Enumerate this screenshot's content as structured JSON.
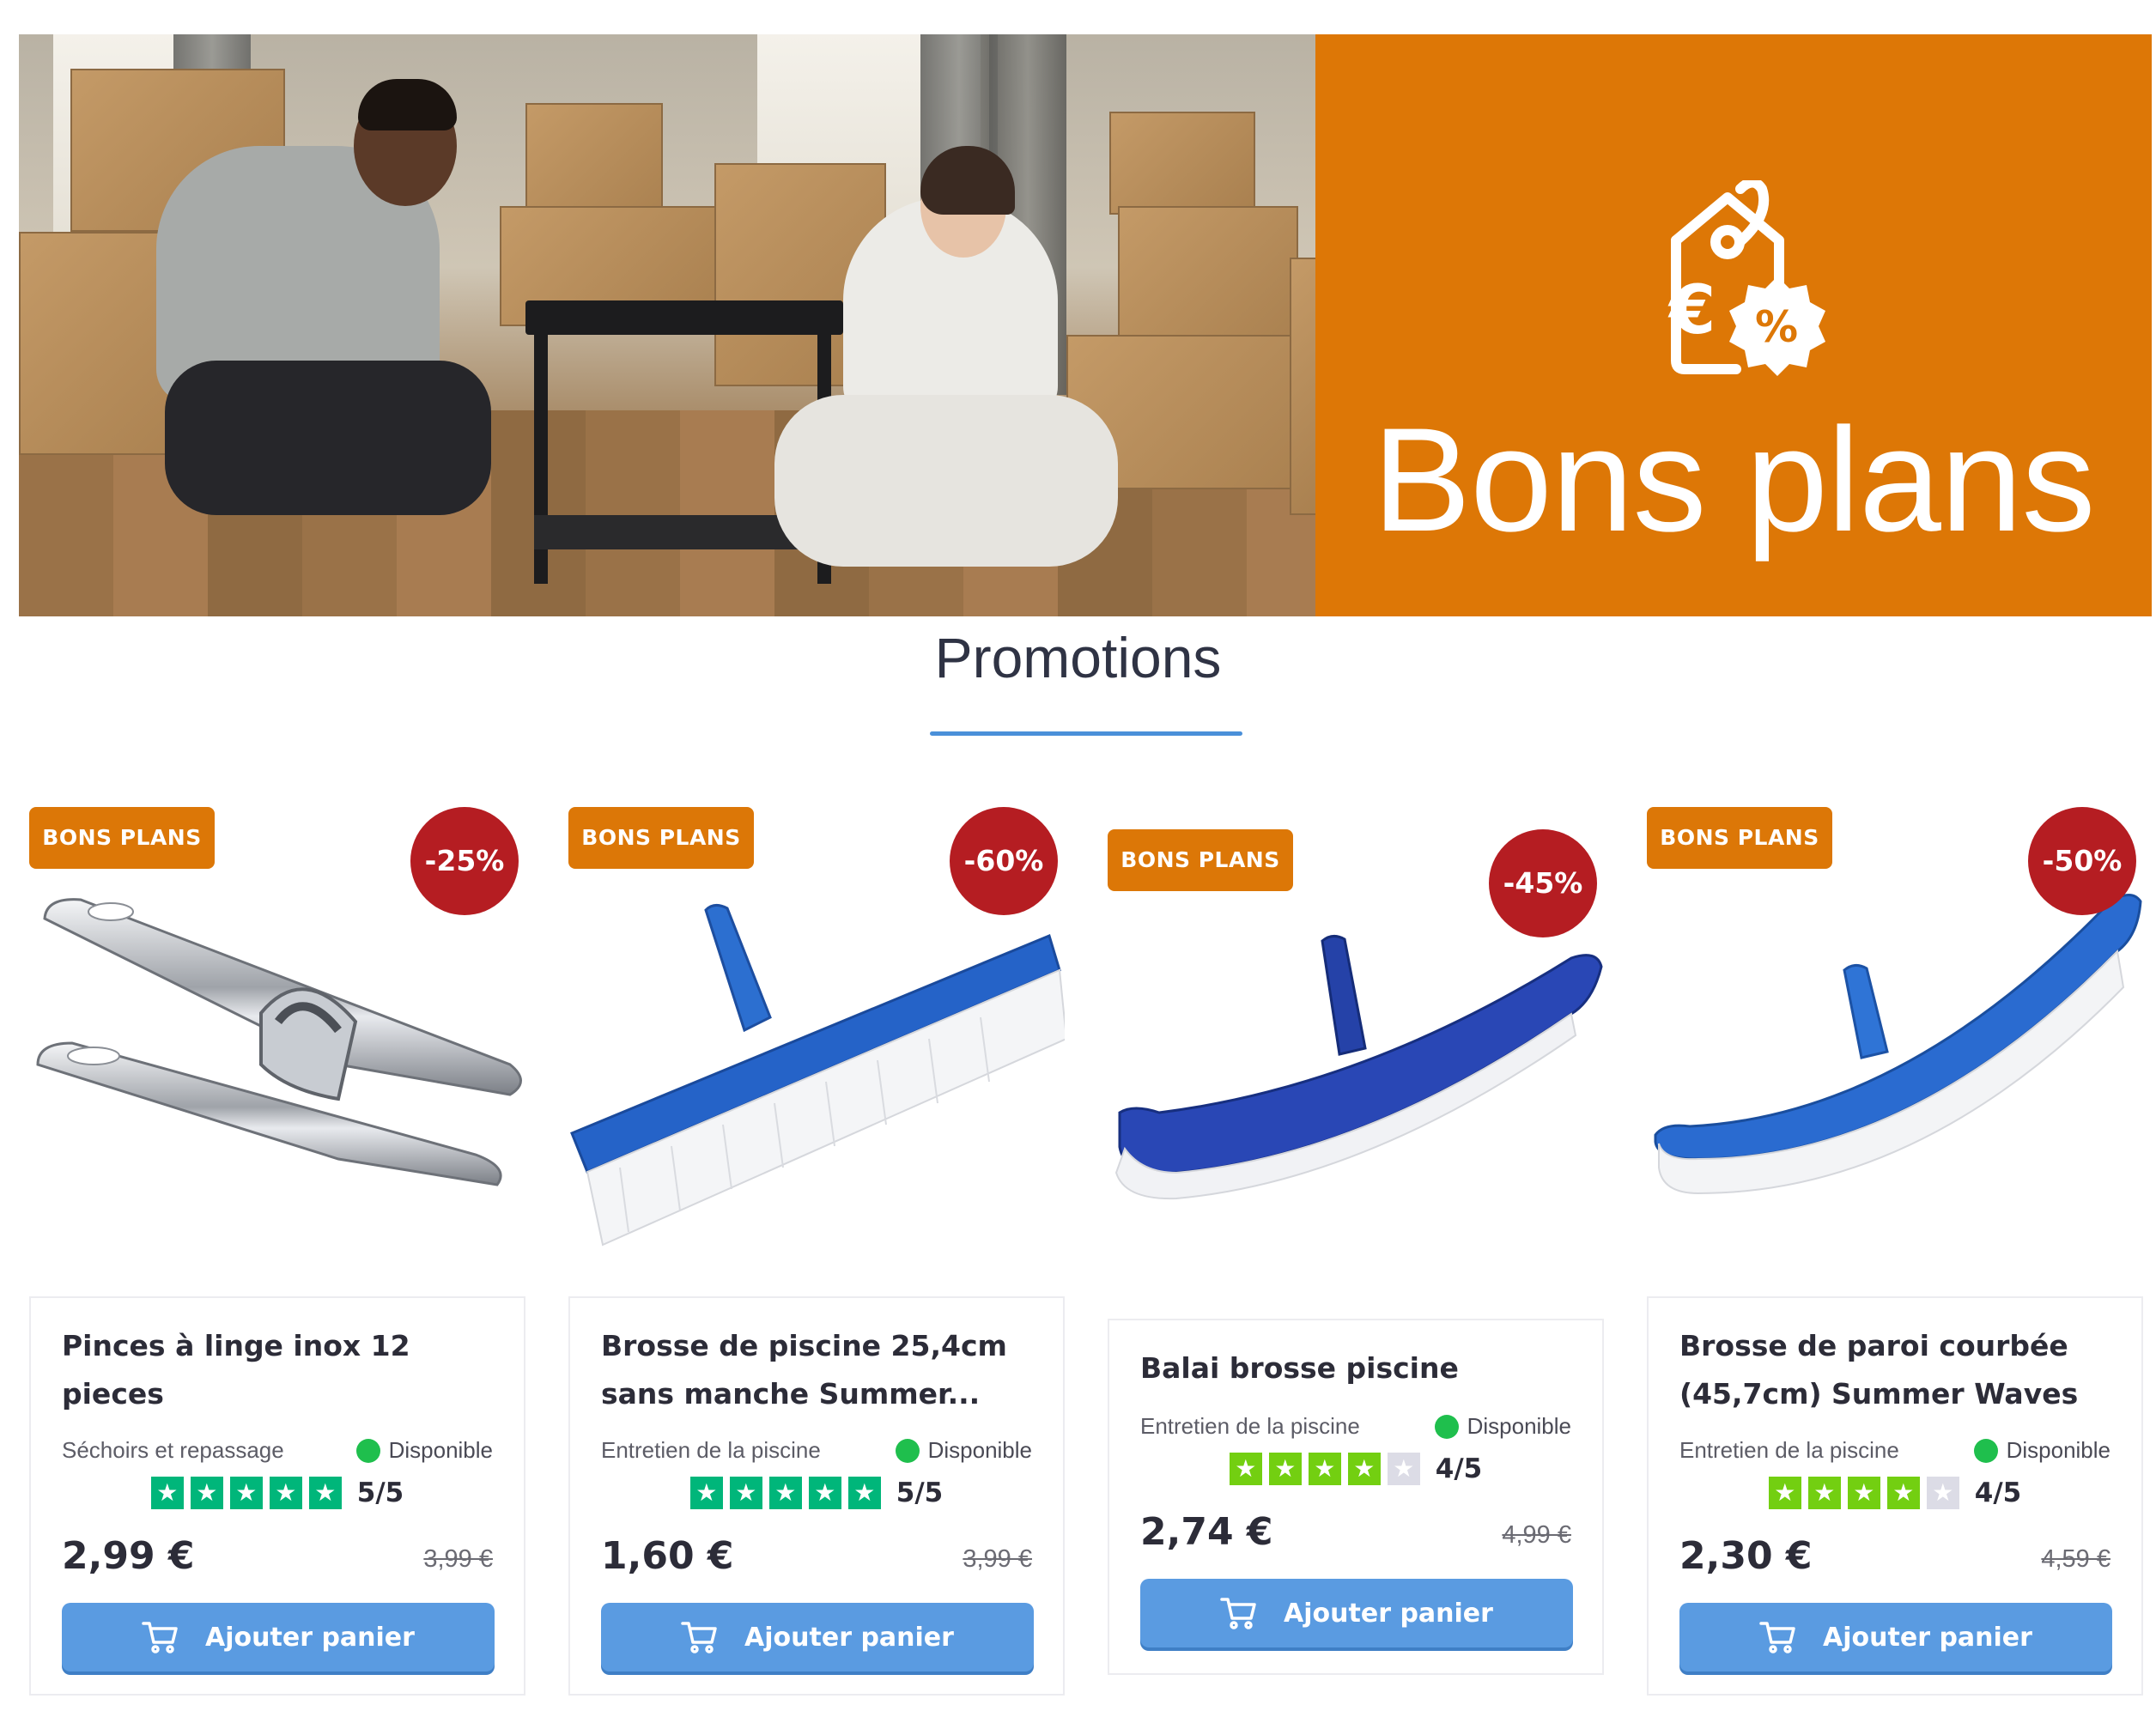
{
  "banner": {
    "brand_text": "Bons plans",
    "brand_color": "#dd7706",
    "icon": "price-tag-euro-percent-icon",
    "photo_description_name": "hero-photo"
  },
  "section": {
    "title": "Promotions",
    "underline_color": "#4a90d9"
  },
  "products": [
    {
      "tag": "BONS PLANS",
      "discount": "-25%",
      "title_line1": "Pinces à linge inox 12",
      "title_line2": "pieces",
      "category": "Séchoirs et repassage",
      "stock": "Disponible",
      "rating": 5,
      "rating_text": "5/5",
      "price": "2,99 €",
      "old_price": "3,99 €",
      "button": "Ajouter panier"
    },
    {
      "tag": "BONS PLANS",
      "discount": "-60%",
      "title_line1": "Brosse de piscine 25,4cm",
      "title_line2": "sans manche Summer...",
      "category": "Entretien de la piscine",
      "stock": "Disponible",
      "rating": 5,
      "rating_text": "5/5",
      "price": "1,60 €",
      "old_price": "3,99 €",
      "button": "Ajouter panier"
    },
    {
      "tag": "BONS PLANS",
      "discount": "-45%",
      "title_line1": "Balai brosse piscine",
      "title_line2": "",
      "category": "Entretien de la piscine",
      "stock": "Disponible",
      "rating": 4,
      "rating_text": "4/5",
      "price": "2,74 €",
      "old_price": "4,99 €",
      "button": "Ajouter panier"
    },
    {
      "tag": "BONS PLANS",
      "discount": "-50%",
      "title_line1": "Brosse de paroi courbée",
      "title_line2": "(45,7cm) Summer Waves",
      "category": "Entretien de la piscine",
      "stock": "Disponible",
      "rating": 4,
      "rating_text": "4/5",
      "price": "2,30 €",
      "old_price": "4,59 €",
      "button": "Ajouter panier"
    }
  ],
  "colors": {
    "tag": "#dc7707",
    "discount": "#b51d22",
    "button": "#5a9be1",
    "stock": "#1fbf4d",
    "star_5": "#00b67a",
    "star_4": "#73cf11"
  }
}
